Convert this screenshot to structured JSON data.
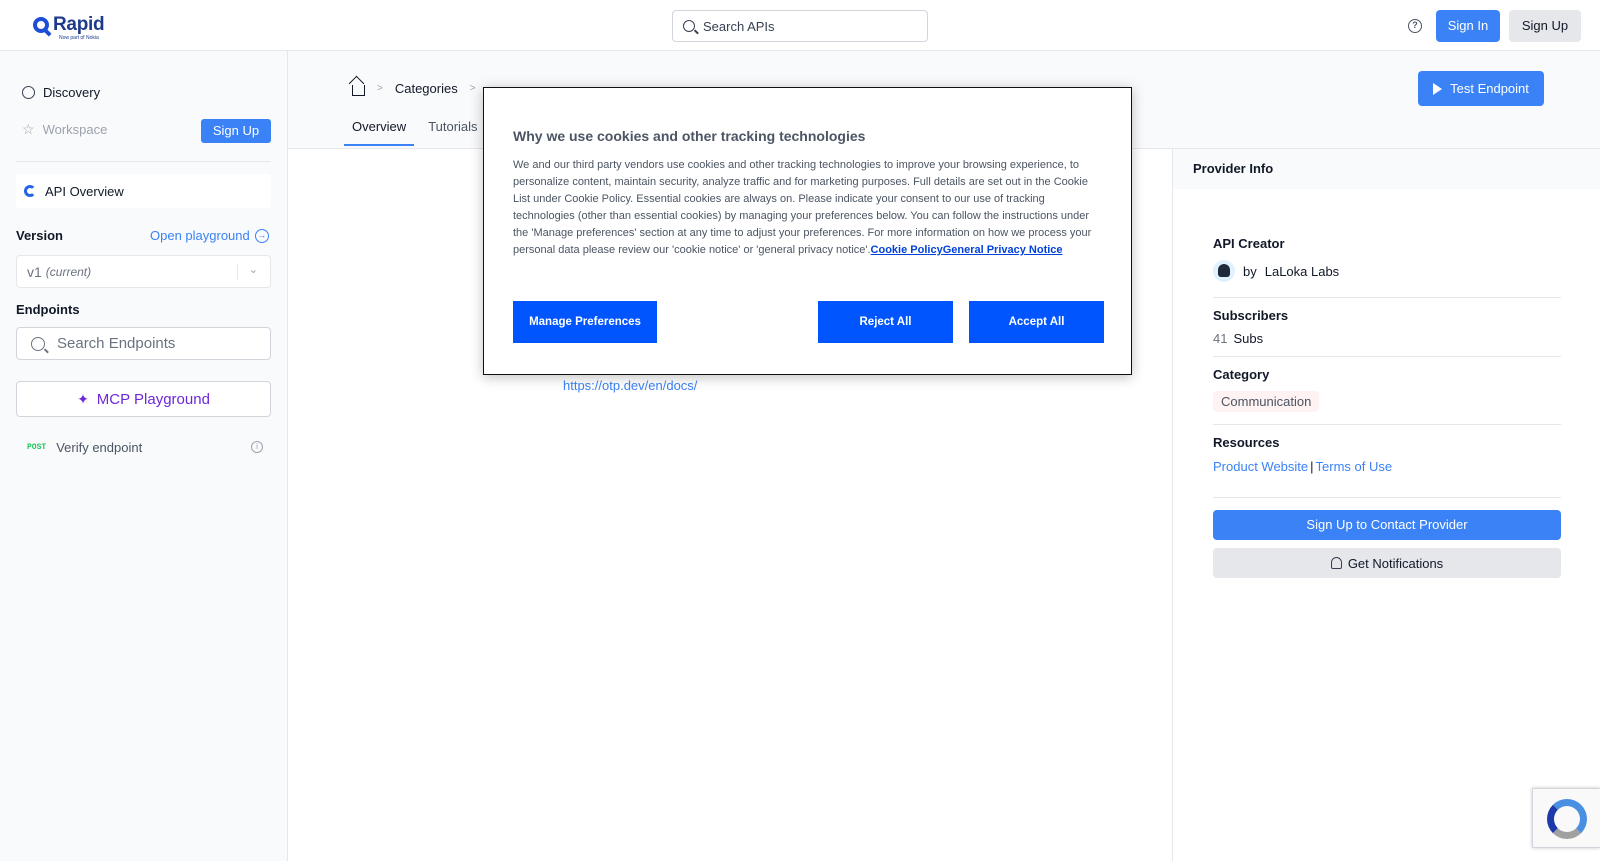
{
  "header": {
    "logo_name": "Rapid",
    "logo_sub": "Now part of Nokia",
    "search_placeholder": "Search APIs",
    "signin": "Sign In",
    "signup": "Sign Up"
  },
  "sidebar": {
    "discovery": "Discovery",
    "workspace": "Workspace",
    "signup": "Sign Up",
    "api_overview": "API Overview",
    "version_label": "Version",
    "open_playground": "Open playground",
    "version_value": "v1",
    "version_current": "(current)",
    "endpoints_label": "Endpoints",
    "search_endpoints": "Search Endpoints",
    "mcp_playground": "MCP Playground",
    "endpoint_method": "POST",
    "endpoint_name": "Verify endpoint"
  },
  "main": {
    "breadcrumb": [
      "Categories"
    ],
    "tabs": [
      "Overview",
      "Tutorials"
    ],
    "test_endpoint": "Test Endpoint",
    "doc_link": "https://otp.dev/en/docs/"
  },
  "provider": {
    "header": "Provider Info",
    "api_creator_label": "API Creator",
    "creator_prefix": "by",
    "creator_name": "LaLoka Labs",
    "subscribers_label": "Subscribers",
    "subscribers_count": "41",
    "subscribers_unit": "Subs",
    "category_label": "Category",
    "category_value": "Communication",
    "resources_label": "Resources",
    "product_website": "Product Website",
    "terms_of_use": "Terms of Use",
    "contact_button": "Sign Up to Contact Provider",
    "notifications_button": "Get Notifications"
  },
  "cookie": {
    "title": "Why we use cookies and other tracking technologies",
    "body": "We and our third party vendors use cookies and other tracking technologies to improve your browsing experience, to personalize content, maintain security, analyze traffic and for marketing purposes. Full details are set out in the Cookie List under Cookie Policy. Essential cookies are always on. Please indicate your consent to our use of tracking technologies (other than essential cookies) by managing your preferences below. You can follow the instructions under the 'Manage preferences' section at any time to adjust your preferences. For more information on how we process your personal data please review our 'cookie notice' or 'general privacy notice'.",
    "cookie_policy_link": "Cookie Policy",
    "privacy_notice_link": "General Privacy Notice",
    "manage_preferences": "Manage Preferences",
    "reject_all": "Reject All",
    "accept_all": "Accept All"
  },
  "colors": {
    "primary": "#3b82f6",
    "cookie_button": "#0055ff",
    "mcp": "#6d28d9",
    "post_badge": "#22c55e"
  },
  "icons": [
    "search-icon",
    "help-icon",
    "discovery-icon",
    "star-icon",
    "api-icon",
    "arrow-right-circle-icon",
    "chevron-down-icon",
    "sparkle-icon",
    "info-icon",
    "home-icon",
    "play-icon",
    "bell-icon"
  ]
}
